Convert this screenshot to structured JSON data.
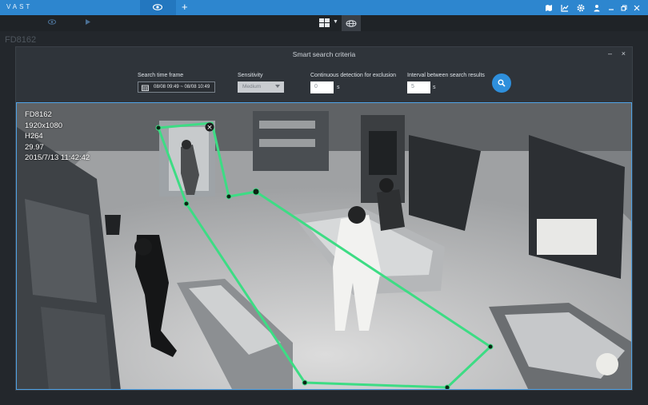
{
  "app": {
    "logo": "VAST"
  },
  "topbar": {
    "tabs": [
      {
        "icon": "eye-icon",
        "active": true
      }
    ],
    "add_tab_label": "+",
    "right_icons": [
      "map-icon",
      "trend-chart-icon",
      "gear-icon",
      "user-icon",
      "minimize-icon",
      "restore-icon",
      "close-icon"
    ],
    "colors": {
      "bar": "#2d86cf",
      "active_tab": "#2377bf"
    }
  },
  "toolbar": {
    "layout_icon": "grid-layout-icon",
    "fisheye_icon": "fisheye-icon"
  },
  "background_label": "FD8162",
  "dialog": {
    "title": "Smart search criteria",
    "minimize": "–",
    "close": "×",
    "time_frame": {
      "label": "Search time frame",
      "value": "08/08 09:49  ~  08/08 10:49"
    },
    "sensitivity": {
      "label": "Sensitivity",
      "value": "Medium",
      "enabled": false
    },
    "exclusion": {
      "label": "Continuous detection for exclusion",
      "value": "0",
      "unit": "s"
    },
    "interval": {
      "label": "Interval between search results",
      "value": "5",
      "unit": "s"
    },
    "search_button": {
      "icon": "search-icon",
      "color": "#2e8fdc"
    }
  },
  "video": {
    "osd": {
      "camera": "FD8162",
      "resolution": "1920x1080",
      "codec": "H264",
      "fps": "29.97",
      "timestamp": "2015/7/13 11:42:42"
    },
    "roi_close": "×",
    "roi_color": "#3ddc84"
  }
}
